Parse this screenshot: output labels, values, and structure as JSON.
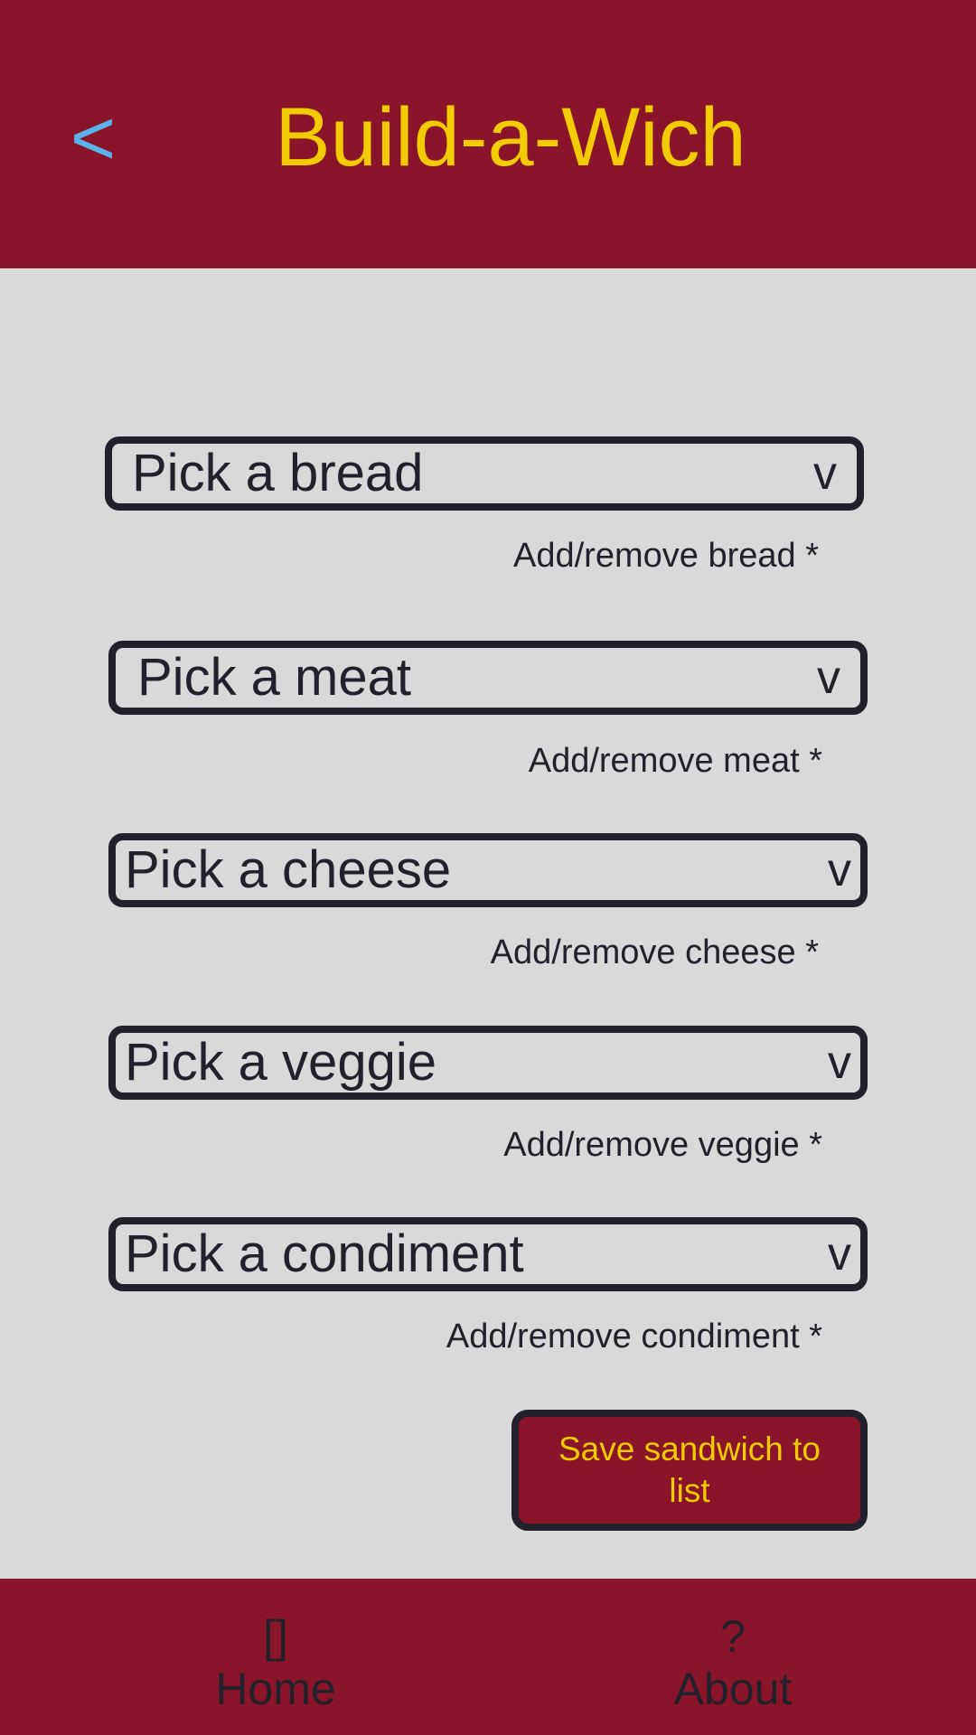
{
  "header": {
    "back_label": "<",
    "title": "Build-a-Wich"
  },
  "selectors": [
    {
      "label": "Pick a bread",
      "arrow": "v",
      "add_remove": "Add/remove bread *"
    },
    {
      "label": "Pick a meat",
      "arrow": "v",
      "add_remove": "Add/remove meat *"
    },
    {
      "label": "Pick a cheese",
      "arrow": "v",
      "add_remove": "Add/remove cheese *"
    },
    {
      "label": "Pick a veggie",
      "arrow": "v",
      "add_remove": "Add/remove veggie *"
    },
    {
      "label": "Pick a condiment",
      "arrow": "v",
      "add_remove": "Add/remove condiment *"
    }
  ],
  "save_button": {
    "label": "Save sandwich to list"
  },
  "bottom_nav": {
    "home": {
      "icon_glyph": "[]",
      "label": "Home",
      "icon": "home-icon"
    },
    "about": {
      "icon_glyph": "?",
      "label": "About",
      "icon": "question-icon"
    }
  },
  "colors": {
    "header_bg": "#8a152b",
    "title": "#f2cb04",
    "back_arrow": "#58b4ea",
    "page_bg": "#d9d9d9",
    "text": "#22212b"
  }
}
